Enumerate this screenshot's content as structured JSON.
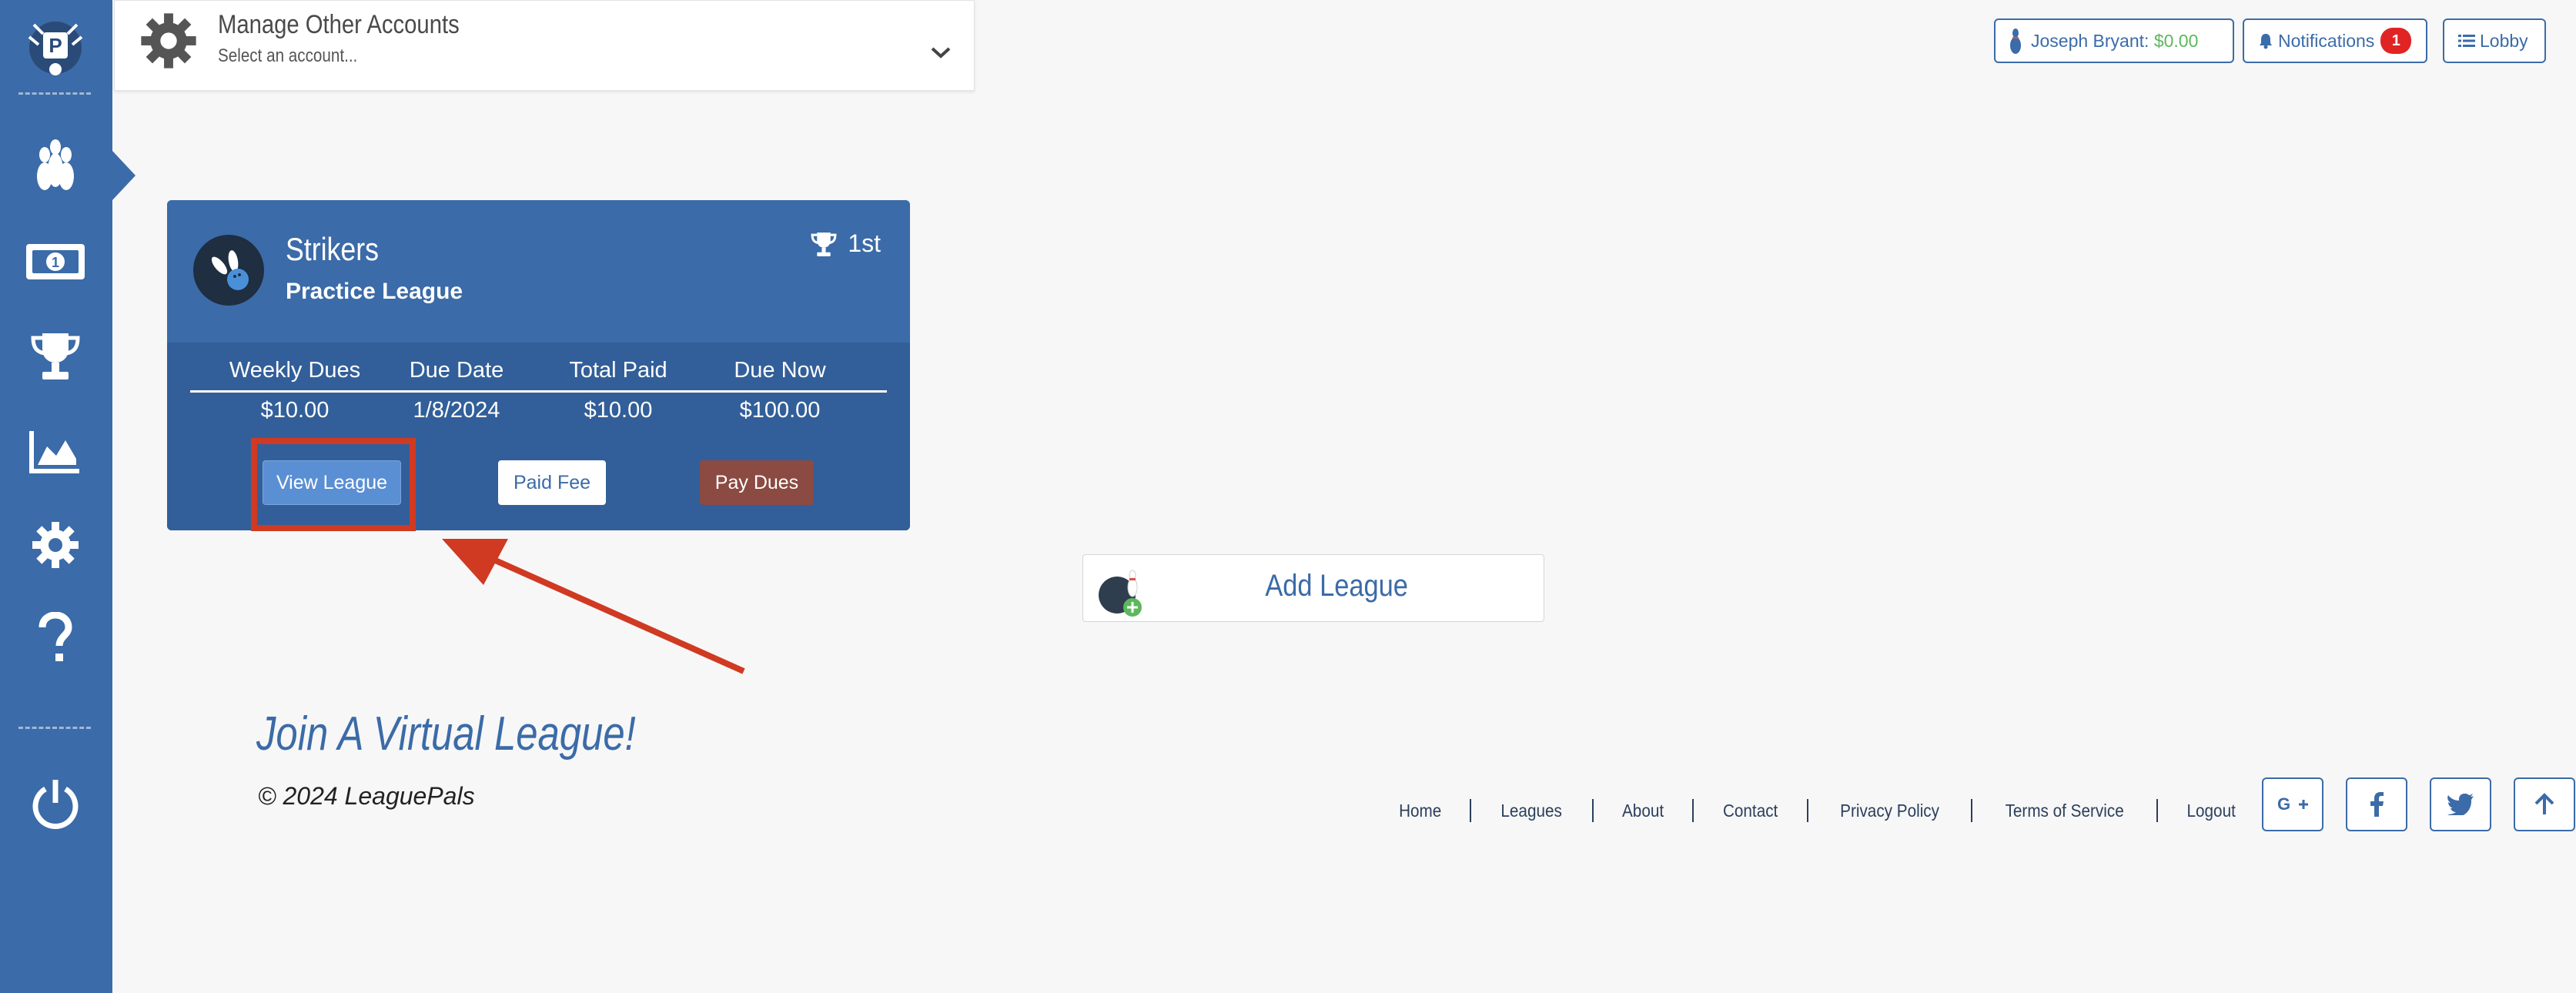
{
  "sidebar": {
    "icons": [
      "bowling-pins-icon",
      "money-icon",
      "trophy-icon",
      "area-chart-icon",
      "gear-icon",
      "question-icon",
      "power-icon"
    ]
  },
  "manage_accounts": {
    "title": "Manage Other Accounts",
    "placeholder": "Select an account..."
  },
  "topbar": {
    "user_name": "Joseph Bryant:",
    "user_balance": "$0.00",
    "notifications_label": "Notifications",
    "notifications_count": "1",
    "lobby_label": "Lobby"
  },
  "league_card": {
    "team_name": "Strikers",
    "league_type": "Practice League",
    "rank": "1st",
    "columns": [
      "Weekly Dues",
      "Due Date",
      "Total Paid",
      "Due Now"
    ],
    "values": [
      "$10.00",
      "1/8/2024",
      "$10.00",
      "$100.00"
    ],
    "view_league_label": "View League",
    "paid_fee_label": "Paid Fee",
    "pay_dues_label": "Pay Dues"
  },
  "add_league": {
    "label": "Add League"
  },
  "footer": {
    "join_text": "Join A Virtual League!",
    "copyright": "© 2024 LeaguePals",
    "links": [
      "Home",
      "Leagues",
      "About",
      "Contact",
      "Privacy Policy",
      "Terms of Service",
      "Logout"
    ]
  },
  "colors": {
    "primary": "#3b6ba8",
    "annotation": "#d03a22",
    "pay_dues": "#8b4a42",
    "balance": "#5cb85c",
    "badge": "#e02424"
  }
}
